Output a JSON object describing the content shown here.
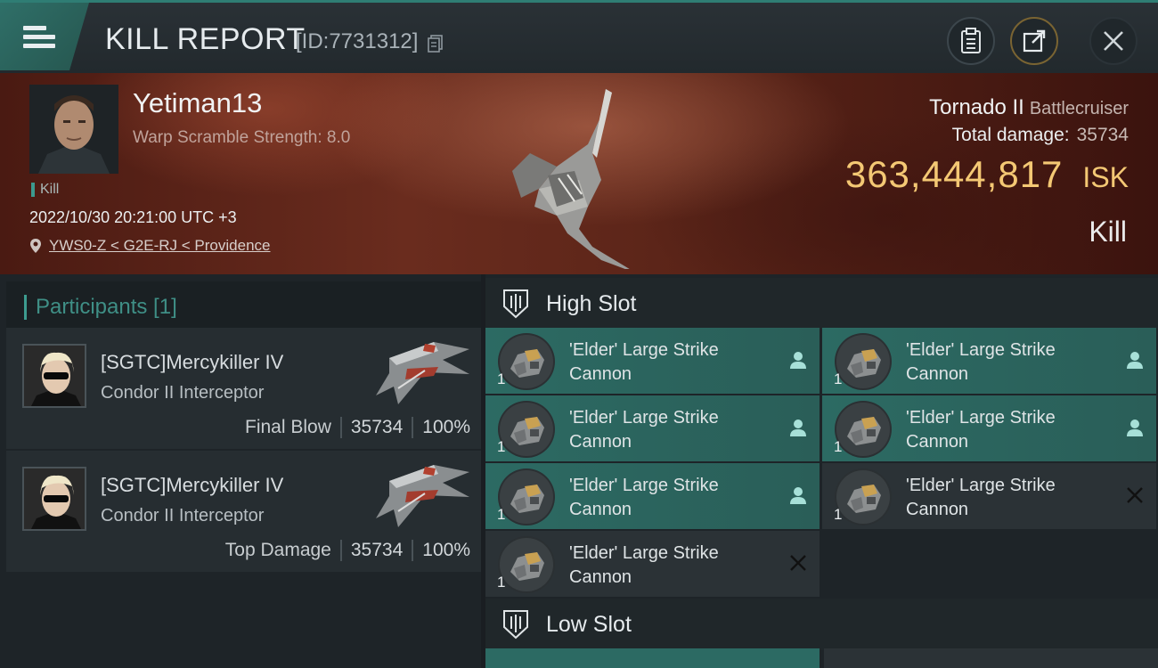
{
  "header": {
    "title": "KILL REPORT",
    "id_label": "[ID:7731312]"
  },
  "victim": {
    "pilot_name": "Yetiman13",
    "warp_scramble": "Warp Scramble Strength: 8.0",
    "tag": "Kill",
    "datetime": "2022/10/30 20:21:00 UTC +3",
    "location": "YWS0-Z < G2E-RJ < Providence",
    "ship_name": "Tornado II",
    "ship_class": "Battlecruiser",
    "total_damage_label": "Total damage:",
    "total_damage_value": "35734",
    "isk_value": "363,444,817",
    "isk_unit": "ISK",
    "status": "Kill"
  },
  "participants": {
    "title": "Participants [1]",
    "items": [
      {
        "name": "[SGTC]Mercykiller IV",
        "ship": "Condor II Interceptor",
        "label": "Final Blow",
        "damage": "35734",
        "percent": "100%"
      },
      {
        "name": "[SGTC]Mercykiller IV",
        "ship": "Condor II Interceptor",
        "label": "Top Damage",
        "damage": "35734",
        "percent": "100%"
      }
    ]
  },
  "slots": {
    "high_slot_title": "High Slot",
    "low_slot_title": "Low Slot",
    "high": [
      {
        "name_line1": "'Elder' Large Strike",
        "name_line2": "Cannon",
        "qty": "1",
        "status": "dropped",
        "status_icon": "person-icon"
      },
      {
        "name_line1": "'Elder' Large Strike",
        "name_line2": "Cannon",
        "qty": "1",
        "status": "dropped",
        "status_icon": "person-icon"
      },
      {
        "name_line1": "'Elder' Large Strike",
        "name_line2": "Cannon",
        "qty": "1",
        "status": "dropped",
        "status_icon": "person-icon"
      },
      {
        "name_line1": "'Elder' Large Strike",
        "name_line2": "Cannon",
        "qty": "1",
        "status": "dropped",
        "status_icon": "person-icon"
      },
      {
        "name_line1": "'Elder' Large Strike",
        "name_line2": "Cannon",
        "qty": "1",
        "status": "dropped",
        "status_icon": "person-icon"
      },
      {
        "name_line1": "'Elder' Large Strike",
        "name_line2": "Cannon",
        "qty": "1",
        "status": "destroyed",
        "status_icon": "x-icon"
      },
      {
        "name_line1": "'Elder' Large Strike",
        "name_line2": "Cannon",
        "qty": "1",
        "status": "destroyed",
        "status_icon": "x-icon"
      }
    ]
  },
  "colors": {
    "accent_teal": "#3d9c90",
    "dropped_bg": "#2c6a63",
    "isk_gold": "#f4c874"
  }
}
